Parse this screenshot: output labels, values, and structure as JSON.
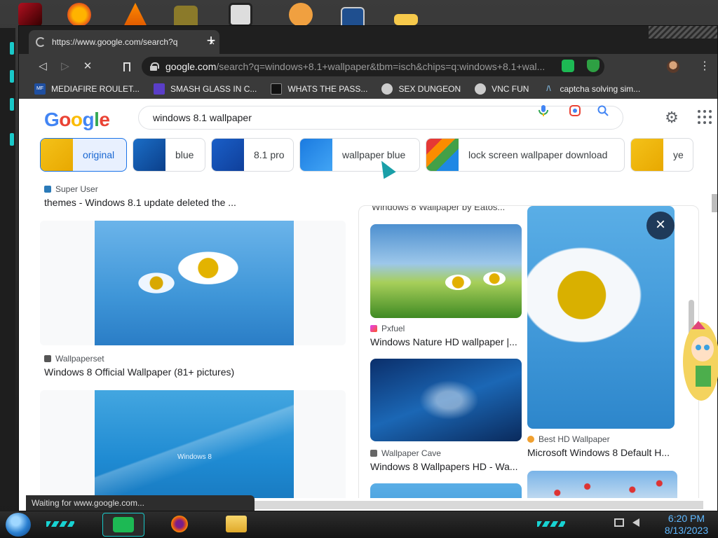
{
  "browser": {
    "tab": {
      "title": "https://www.google.com/search?q",
      "close": "×"
    },
    "new_tab": "+",
    "address": {
      "domain": "google.com",
      "path": "/search?q=windows+8.1+wallpaper&tbm=isch&chips=q:windows+8.1+wal..."
    },
    "nav": {
      "back": "◁",
      "forward": "▷",
      "stop": "✕",
      "bookmark": "⌂",
      "menu": "⋮"
    },
    "bookmarks": [
      {
        "label": "MEDIAFIRE ROULET...",
        "icon": "MF"
      },
      {
        "label": "SMASH GLASS IN C...",
        "icon": ""
      },
      {
        "label": "WHATS THE PASS...",
        "icon": ""
      },
      {
        "label": "SEX DUNGEON",
        "icon": ""
      },
      {
        "label": "VNC FUN",
        "icon": ""
      },
      {
        "label": "captcha solving sim...",
        "icon": "/\\"
      }
    ],
    "status_text": "Waiting for www.google.com..."
  },
  "google": {
    "logo": {
      "G": "G",
      "o1": "o",
      "o2": "o",
      "g": "g",
      "l": "l",
      "e": "e"
    },
    "query": "windows 8.1 wallpaper",
    "chips": [
      {
        "label": "original",
        "selected": true
      },
      {
        "label": "blue"
      },
      {
        "label": "8.1 pro"
      },
      {
        "label": "wallpaper blue"
      },
      {
        "label": "lock screen wallpaper download"
      },
      {
        "label": "ye"
      }
    ],
    "chip_next": "›",
    "left_results": [
      {
        "source": "Super User",
        "title": "themes - Windows 8.1 update deleted the ..."
      },
      {
        "source": "Wallpaperset",
        "title": "Windows 8 Official Wallpaper (81+ pictures)"
      },
      {
        "image_caption": "Windows 8"
      }
    ],
    "panel": {
      "close": "×",
      "top_caption": "Windows 8 Wallpaper by Eatos...",
      "results": [
        {
          "source": "Pxfuel",
          "title": "Windows Nature HD wallpaper |..."
        },
        {
          "source": "Wallpaper Cave",
          "title": "Windows 8 Wallpapers HD - Wa..."
        },
        {
          "source": "Best HD Wallpaper",
          "title": "Microsoft Windows 8 Default H..."
        }
      ]
    }
  },
  "taskbar": {
    "clock_time": "6:20 PM",
    "clock_date": "8/13/2023"
  },
  "colors": {
    "google_blue": "#4285F4",
    "google_red": "#EA4335",
    "google_yellow": "#FBBC05",
    "google_green": "#34A853",
    "accent_cyan": "#19c8c8"
  }
}
